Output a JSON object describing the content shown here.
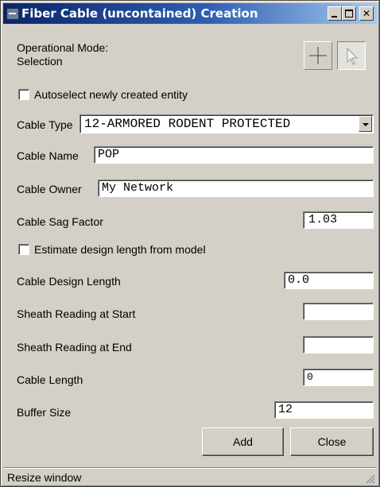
{
  "window": {
    "title": "Fiber Cable (uncontained) Creation",
    "controls": [
      "minimize",
      "maximize",
      "close"
    ]
  },
  "mode": {
    "label_line1": "Operational Mode:",
    "label_line2": "Selection",
    "tools": [
      {
        "name": "crosshair-tool",
        "icon": "crosshair-icon",
        "active": false
      },
      {
        "name": "select-tool",
        "icon": "arrow-cursor-icon",
        "active": true
      }
    ]
  },
  "autoselect": {
    "label": "Autoselect newly created entity",
    "checked": false
  },
  "cable_type": {
    "label": "Cable Type",
    "value": "12-ARMORED RODENT PROTECTED"
  },
  "cable_name": {
    "label": "Cable Name",
    "value": "POP"
  },
  "cable_owner": {
    "label": "Cable Owner",
    "value": "My Network"
  },
  "sag_factor": {
    "label": "Cable Sag Factor",
    "value": "1.03"
  },
  "estimate": {
    "label": "Estimate design length from model",
    "checked": false
  },
  "design_length": {
    "label": "Cable Design Length",
    "value": "0.0"
  },
  "sheath_start": {
    "label": "Sheath Reading at Start",
    "value": ""
  },
  "sheath_end": {
    "label": "Sheath Reading at End",
    "value": ""
  },
  "cable_length": {
    "label": "Cable Length",
    "value": "0"
  },
  "buffer_size": {
    "label": "Buffer Size",
    "value": "12"
  },
  "buttons": {
    "add": "Add",
    "close": "Close"
  },
  "status": {
    "text": "Resize window"
  }
}
